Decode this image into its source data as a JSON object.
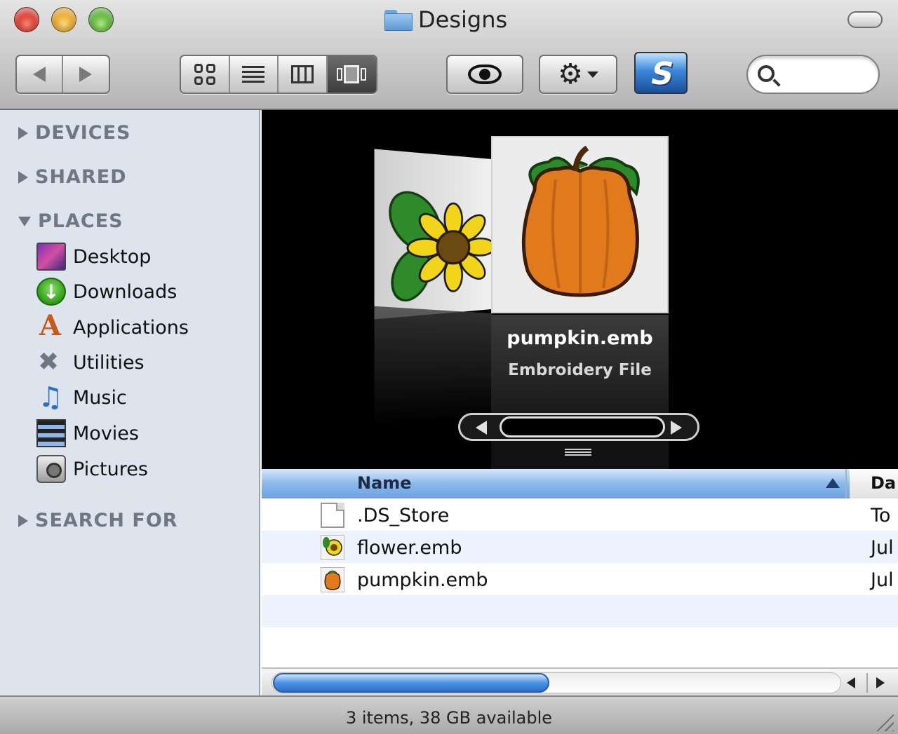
{
  "window": {
    "title": "Designs"
  },
  "toolbar": {
    "back_icon": "back-arrow-icon",
    "forward_icon": "forward-arrow-icon",
    "view_modes": [
      "icon-view",
      "list-view",
      "column-view",
      "cover-flow-view"
    ],
    "active_view": "cover-flow-view",
    "quick_look_icon": "eye-icon",
    "action_icon": "gear-icon",
    "search": {
      "value": "",
      "placeholder": ""
    }
  },
  "sidebar": {
    "sections": {
      "devices": "DEVICES",
      "shared": "SHARED",
      "places": "PLACES",
      "search_for": "SEARCH FOR"
    },
    "places": [
      {
        "label": "Desktop",
        "icon": "desktop-icon"
      },
      {
        "label": "Downloads",
        "icon": "downloads-icon"
      },
      {
        "label": "Applications",
        "icon": "applications-icon"
      },
      {
        "label": "Utilities",
        "icon": "utilities-icon"
      },
      {
        "label": "Music",
        "icon": "music-icon"
      },
      {
        "label": "Movies",
        "icon": "movies-icon"
      },
      {
        "label": "Pictures",
        "icon": "pictures-icon"
      }
    ]
  },
  "coverflow": {
    "selected_name": "pumpkin.emb",
    "selected_kind": "Embroidery File"
  },
  "list": {
    "columns": {
      "name": "Name",
      "date": "Da"
    },
    "sort": "ascending",
    "rows": [
      {
        "name": ".DS_Store",
        "date": "To",
        "icon": "document-icon"
      },
      {
        "name": "flower.emb",
        "date": "Jul",
        "icon": "flower-embroidery-icon"
      },
      {
        "name": "pumpkin.emb",
        "date": "Jul",
        "icon": "pumpkin-embroidery-icon"
      }
    ]
  },
  "statusbar": {
    "text": "3 items, 38 GB available"
  },
  "colors": {
    "sidebar_bg": "#dde4ed",
    "header_blue": "#8fbaeb",
    "row_alt": "#edf3fe",
    "coverflow_bg": "#000000"
  }
}
